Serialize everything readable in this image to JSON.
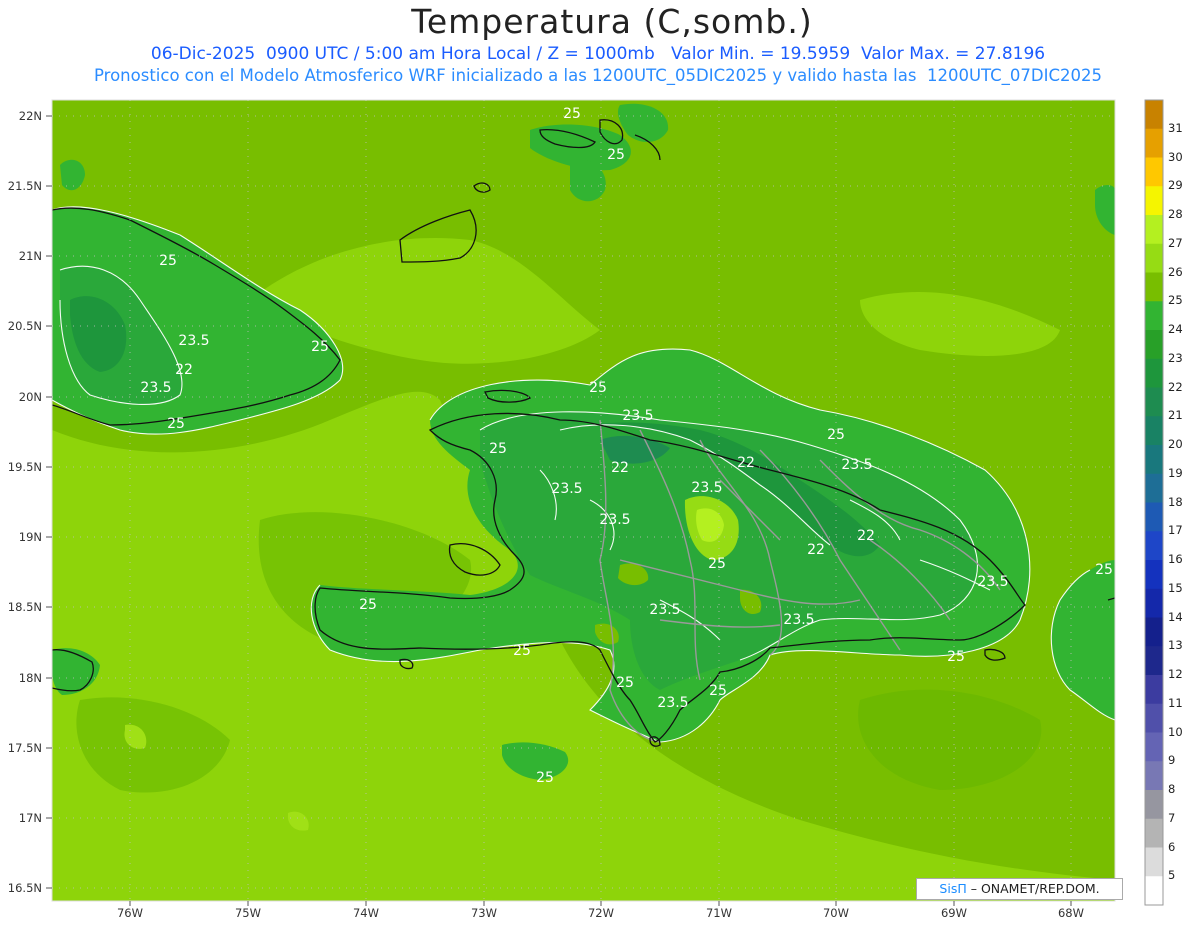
{
  "header": {
    "title": "Temperatura (C,somb.)",
    "line1": "06-Dic-2025  0900 UTC / 5:00 am Hora Local / Z = 1000mb   Valor Min. = 19.5959  Valor Max. = 27.8196",
    "line2": "Pronostico con el Modelo Atmosferico WRF inicializado a las 1200UTC_05DIC2025 y valido hasta las  1200UTC_07DIC2025"
  },
  "axes": {
    "lat_labels": [
      "22N",
      "21.5N",
      "21N",
      "20.5N",
      "20N",
      "19.5N",
      "19N",
      "18.5N",
      "18N",
      "17.5N",
      "17N",
      "16.5N"
    ],
    "lon_labels": [
      "76W",
      "75W",
      "74W",
      "73W",
      "72W",
      "71W",
      "70W",
      "69W",
      "68W"
    ]
  },
  "colorbar": {
    "labels": [
      "31",
      "30",
      "29",
      "28",
      "27",
      "26",
      "25",
      "24",
      "23",
      "22",
      "21",
      "20",
      "19",
      "18",
      "17",
      "16",
      "15",
      "14",
      "13",
      "12",
      "11",
      "10",
      "9",
      "8",
      "7",
      "6",
      "5"
    ],
    "colors": [
      "#c88200",
      "#e6a000",
      "#ffc800",
      "#f5f500",
      "#b4f020",
      "#96dc14",
      "#78be00",
      "#32b432",
      "#28a028",
      "#1e963c",
      "#1e8c50",
      "#198264",
      "#19787d",
      "#1e6e96",
      "#1e5ab4",
      "#1e46c8",
      "#1432be",
      "#1428aa",
      "#14208c",
      "#1e288c",
      "#3c3ca0",
      "#5050aa",
      "#6464b4",
      "#7878b4",
      "#9696a0",
      "#b4b4b4",
      "#dcdcdc",
      "#ffffff"
    ]
  },
  "contour_labels": [
    "25",
    "25",
    "25",
    "25",
    "25",
    "25",
    "25",
    "25",
    "25",
    "25",
    "25",
    "25",
    "25",
    "25",
    "25",
    "23.5",
    "23.5",
    "23.5",
    "23.5",
    "23.5",
    "23.5",
    "23.5",
    "23.5",
    "23.5",
    "23.5",
    "22",
    "22",
    "22",
    "22",
    "22"
  ],
  "credit": {
    "brand": "SisΠ",
    "text": "– ONAMET/REP.DOM."
  }
}
